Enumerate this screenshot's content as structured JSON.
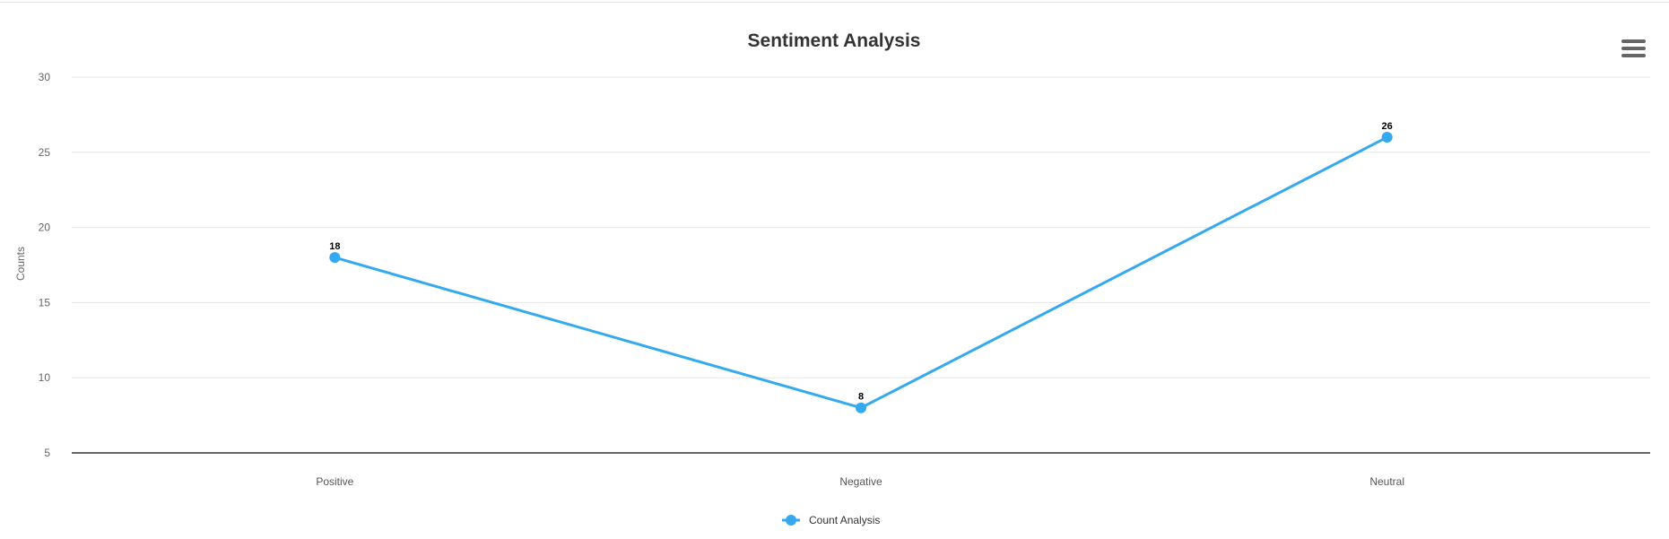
{
  "chart_data": {
    "type": "line",
    "title": "Sentiment Analysis",
    "xlabel": "",
    "ylabel": "Counts",
    "categories": [
      "Positive",
      "Negative",
      "Neutral"
    ],
    "series": [
      {
        "name": "Count Analysis",
        "values": [
          18,
          8,
          26
        ],
        "color": "#35a9f0"
      }
    ],
    "ylim": [
      5,
      30
    ],
    "yticks": [
      5,
      10,
      15,
      20,
      25,
      30
    ],
    "grid": true,
    "data_labels": true,
    "legend_position": "bottom-center"
  },
  "colors": {
    "series": "#35a9f0",
    "grid": "#e6e6e6",
    "axis": "#333333",
    "menu_icon": "#666666"
  },
  "menu_icon": "hamburger-menu-icon"
}
